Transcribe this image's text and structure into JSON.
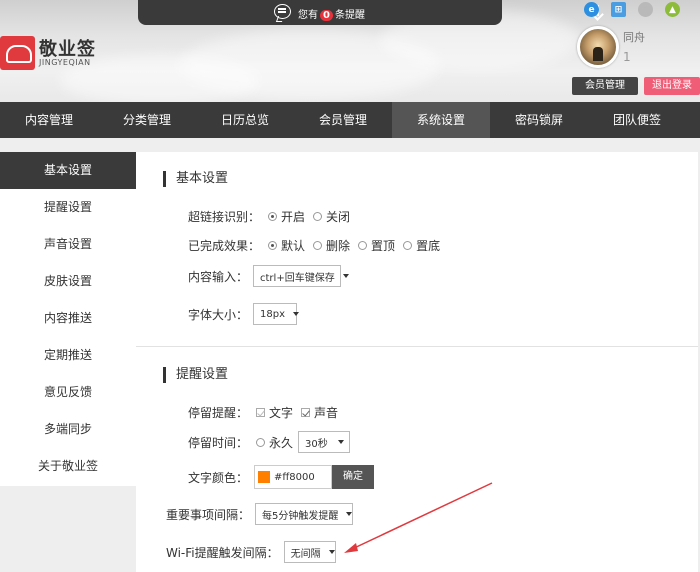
{
  "notify": {
    "prefix": "您有",
    "count": "0",
    "suffix": "条提醒"
  },
  "os_icons": [
    {
      "name": "ie",
      "glyph": "e"
    },
    {
      "name": "windows",
      "glyph": "⊞"
    },
    {
      "name": "apple",
      "glyph": ""
    },
    {
      "name": "android",
      "glyph": "▲"
    }
  ],
  "brand": {
    "title": "敬业签",
    "subtitle": "JINGYEQIAN",
    "color": "#e0393e"
  },
  "user": {
    "name": "同舟",
    "id": "1",
    "member_label": "会员管理",
    "logout_label": "退出登录"
  },
  "nav": [
    "内容管理",
    "分类管理",
    "日历总览",
    "会员管理",
    "系统设置",
    "密码锁屏",
    "团队便签"
  ],
  "nav_active": 4,
  "sidebar": [
    "基本设置",
    "提醒设置",
    "声音设置",
    "皮肤设置",
    "内容推送",
    "定期推送",
    "意见反馈",
    "多端同步",
    "关于敬业签"
  ],
  "sidebar_active": 0,
  "basic": {
    "title": "基本设置",
    "link_label": "超链接识别：",
    "link_opts": [
      "开启",
      "关闭"
    ],
    "done_label": "已完成效果：",
    "done_opts": [
      "默认",
      "删除",
      "置顶",
      "置底"
    ],
    "input_label": "内容输入：",
    "input_value": "ctrl+回车键保存",
    "font_label": "字体大小：",
    "font_value": "18px"
  },
  "remind": {
    "title": "提醒设置",
    "stay_label": "停留提醒：",
    "stay_opts": [
      "文字",
      "声音"
    ],
    "time_label": "停留时间：",
    "time_forever": "永久",
    "time_value": "30秒",
    "color_label": "文字颜色：",
    "color_value": "#ff8000",
    "color_swatch": "#ff8000",
    "ok_label": "确定",
    "important_label": "重要事项间隔：",
    "important_value": "每5分钟触发提醒",
    "wifi_label": "Wi-Fi提醒触发间隔：",
    "wifi_value": "无间隔"
  },
  "annotation_color": "#e0393e"
}
